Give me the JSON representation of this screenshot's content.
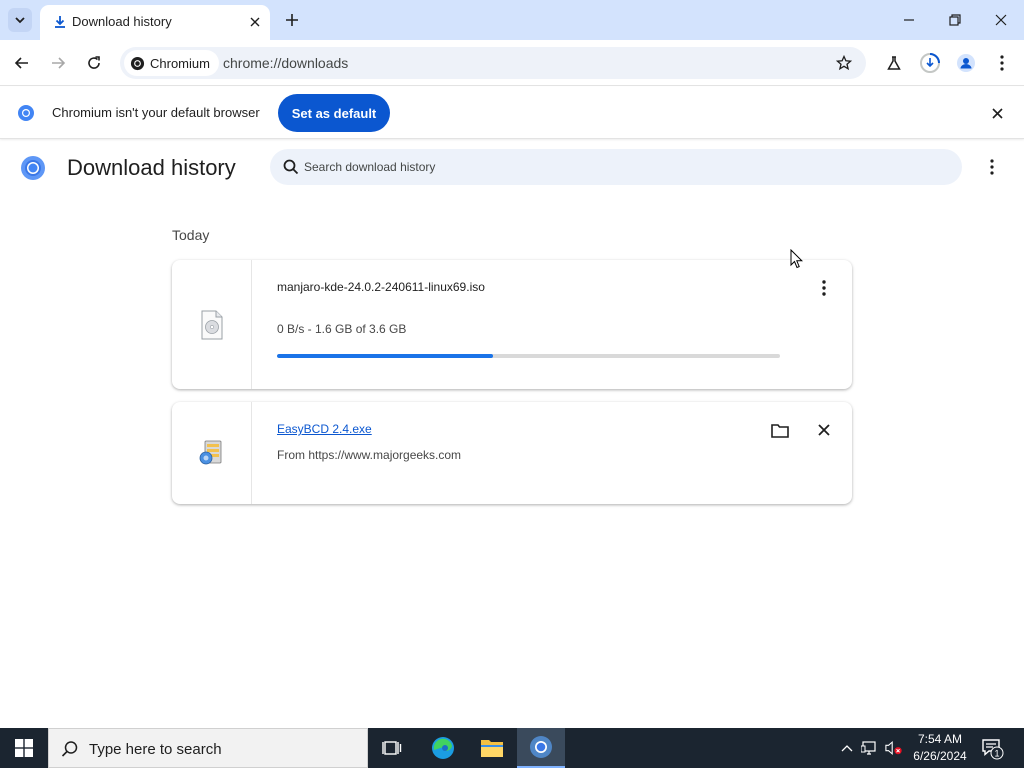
{
  "browser": {
    "tab": {
      "title": "Download history"
    },
    "toolbar": {
      "site_chip": "Chromium",
      "url": "chrome://downloads"
    }
  },
  "infobar": {
    "message": "Chromium isn't your default browser",
    "set_default_label": "Set as default"
  },
  "page": {
    "title": "Download history",
    "search_placeholder": "Search download history",
    "section_date": "Today"
  },
  "downloads": [
    {
      "file_name": "manjaro-kde-24.0.2-240611-linux69.iso",
      "status": "0 B/s - 1.6 GB of 3.6 GB",
      "progress": 0.43,
      "icon": "disc-file-icon"
    },
    {
      "file_name": "EasyBCD 2.4.exe",
      "status": "From https://www.majorgeeks.com",
      "icon": "installer-file-icon"
    }
  ],
  "taskbar": {
    "search_placeholder": "Type here to search",
    "time": "7:54 AM",
    "date": "6/26/2024",
    "notification_count": "1"
  },
  "colors": {
    "tabstrip": "#d3e3fd",
    "accent": "#0b57d0",
    "progress": "#1a73e8",
    "taskbar": "#1b2530"
  }
}
